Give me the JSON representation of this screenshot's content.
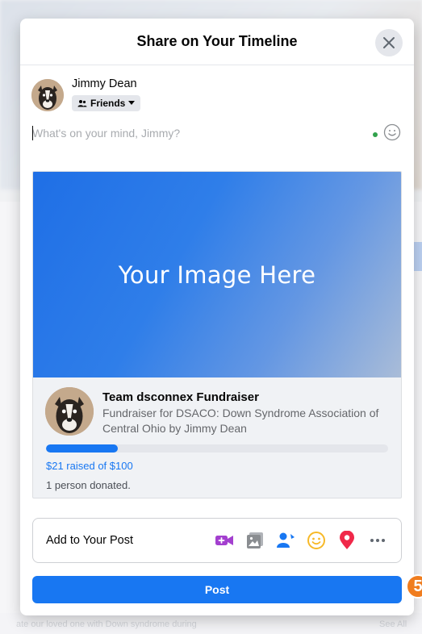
{
  "modal": {
    "title": "Share on Your Timeline",
    "close_icon": "close-icon"
  },
  "author": {
    "name": "Jimmy Dean",
    "audience": "Friends",
    "audience_icon": "friends-icon"
  },
  "composer": {
    "placeholder": "What's on your mind, Jimmy?"
  },
  "attachment": {
    "image_text": "Your Image Here",
    "title": "Team dsconnex Fundraiser",
    "description": "Fundraiser for DSACO: Down Syndrome Association of Central Ohio by Jimmy Dean",
    "progress_fraction": 0.21,
    "raised_text": "$21 raised of $100",
    "donated_text": "1 person donated."
  },
  "add_to_post": {
    "label": "Add to Your Post",
    "icons": [
      "live-video-icon",
      "photo-icon",
      "tag-people-icon",
      "feeling-icon",
      "check-in-icon",
      "more-icon"
    ]
  },
  "post_button": "Post",
  "step_badge": "5",
  "background": {
    "left_text": "ate our loved one with Down syndrome during",
    "right_text": "See All"
  },
  "colors": {
    "accent": "#1877f2",
    "badge": "#f07d1f"
  }
}
